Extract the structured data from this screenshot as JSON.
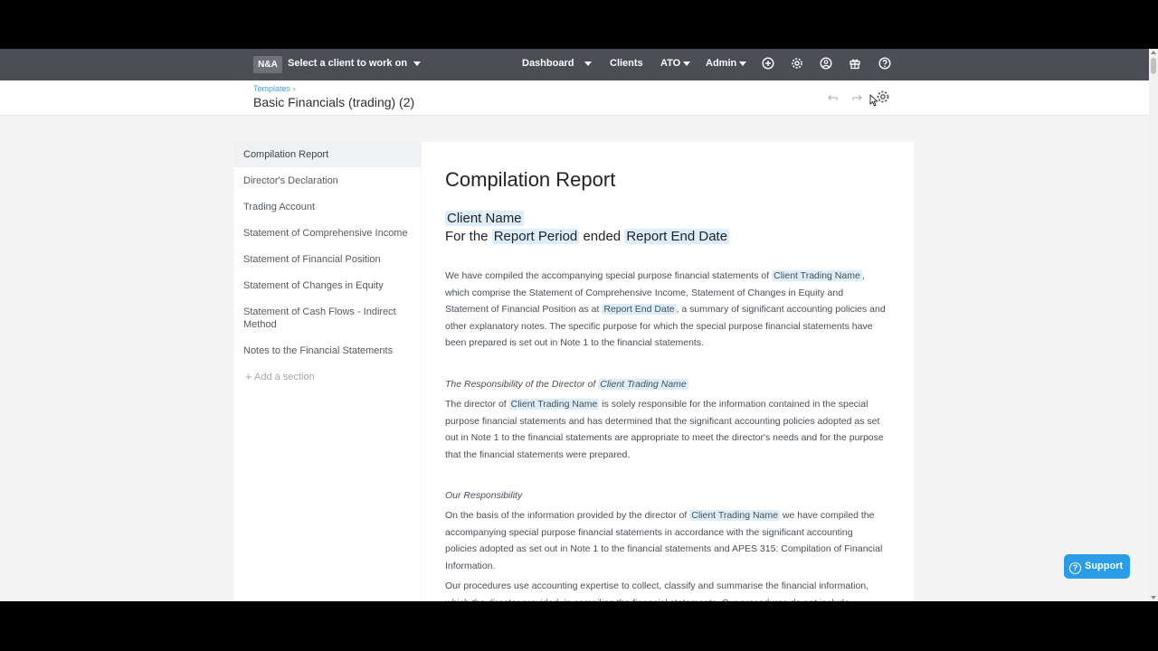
{
  "navbar": {
    "logo": "N&A",
    "client_select": "Select a client to work on",
    "links": [
      "Dashboard",
      "Clients",
      "ATO",
      "Admin"
    ],
    "icons": [
      "plus-circle-icon",
      "gear-icon",
      "user-icon",
      "gift-icon",
      "help-icon"
    ]
  },
  "header": {
    "breadcrumb": "Templates ›",
    "title": "Basic Financials (trading) (2)"
  },
  "sidebar": {
    "items": [
      "Compilation Report",
      "Director's Declaration",
      "Trading Account",
      "Statement of Comprehensive Income",
      "Statement of Financial Position",
      "Statement of Changes in Equity",
      "Statement of Cash Flows - Indirect Method",
      "Notes to the Financial Statements"
    ],
    "active_index": 0,
    "add_section": "Add a section"
  },
  "document": {
    "heading": "Compilation Report",
    "client_name": "Client Name",
    "for_the": "For the",
    "report_period": "Report Period",
    "ended": "ended",
    "report_end_date": "Report End Date",
    "p1_a": "We have compiled the accompanying special purpose financial statements of",
    "client_trading_name": "Client Trading Name",
    "p1_b": ", which comprise the Statement of Comprehensive Income, Statement of Changes in Equity and Statement of Financial Position as at",
    "p1_c": ", a summary of significant accounting policies and other explanatory notes. The specific purpose for which the special purpose financial statements have been prepared is set out in Note 1 to the financial statements.",
    "resp_heading": "The Responsibility of the Director of",
    "p2_a": "The director of",
    "p2_b": "is solely responsible for the information contained in the special purpose financial statements and has determined that the significant accounting policies adopted as set out in Note 1 to the financial statements are appropriate to meet the director's needs and for the purpose that the financial statements were prepared.",
    "our_resp": "Our Responsibility",
    "p3_a": "On the basis of the information provided by the director of",
    "p3_b": "we have compiled the accompanying special purpose financial statements in accordance with the significant accounting policies adopted as set out in Note 1 to the financial statements and APES 315: Compilation of Financial Information.",
    "p4": "Our procedures use accounting expertise to collect, classify and summarise the financial information, which the director provided, in compiling the financial statements. Our procedures do not include"
  },
  "support": {
    "label": "Support"
  },
  "colors": {
    "navbar": "#4b4e55",
    "accent": "#2a9de6",
    "tag_bg": "#ddeefa"
  }
}
